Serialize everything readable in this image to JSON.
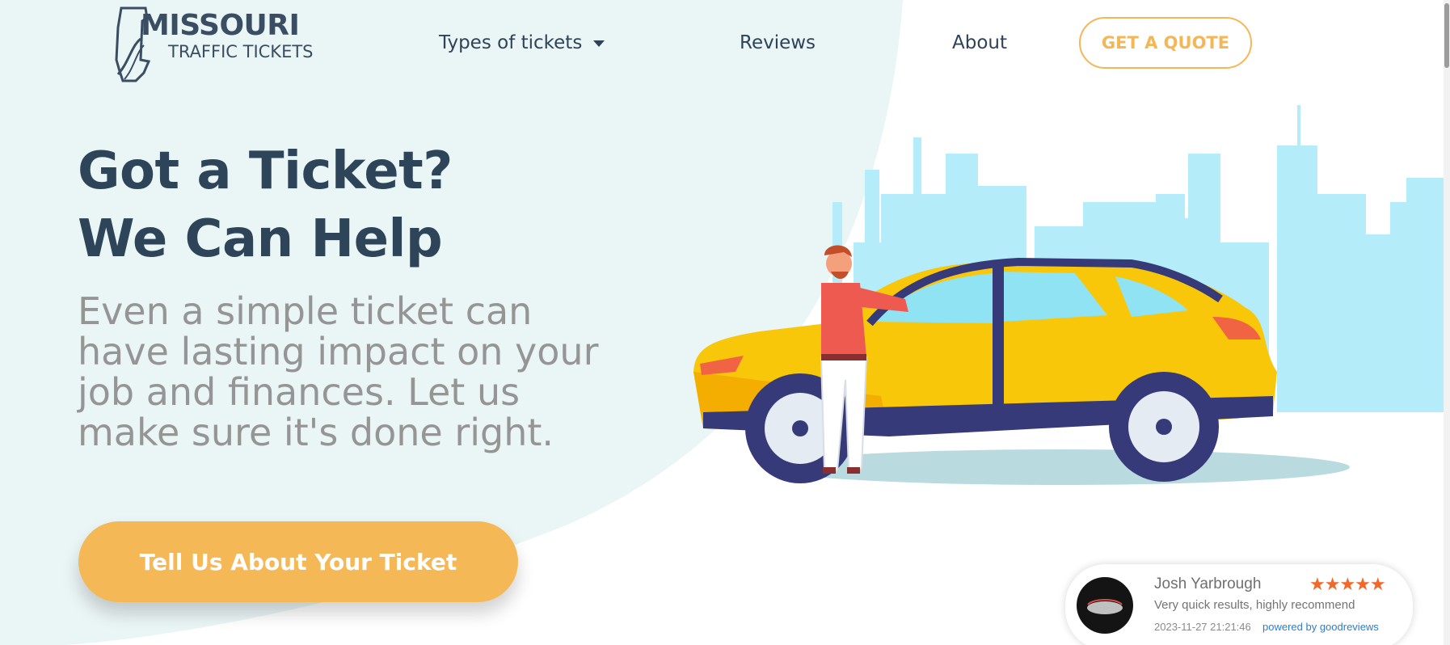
{
  "brand": {
    "title": "MISSOURI",
    "subtitle": "TRAFFIC TICKETS"
  },
  "nav": {
    "types_label": "Types of tickets",
    "reviews_label": "Reviews",
    "about_label": "About",
    "quote_label": "GET A QUOTE"
  },
  "hero": {
    "headline_line1": "Got a Ticket?",
    "headline_line2": "We Can Help",
    "subtext_lines": [
      "Even a simple ticket can",
      "have lasting impact on your",
      "job and finances. Let us",
      "make sure it's done right."
    ],
    "cta_label": "Tell Us About Your Ticket"
  },
  "review": {
    "name": "Josh Yarbrough",
    "stars": "★★★★★",
    "rating": 5,
    "text": "Very quick results, highly recommend",
    "date": "2023-11-27 21:21:46",
    "powered_by": "powered by goodreviews"
  },
  "colors": {
    "navy": "#2d4459",
    "accent": "#f5b756",
    "hero_bg": "#eaf5f6",
    "gray_text": "#959595",
    "star": "#f2672a",
    "skyline": "#b5ecfa",
    "car": "#f8c70a"
  },
  "icons": {
    "caret": "caret-down-icon",
    "logo": "missouri-state-outline-icon"
  }
}
